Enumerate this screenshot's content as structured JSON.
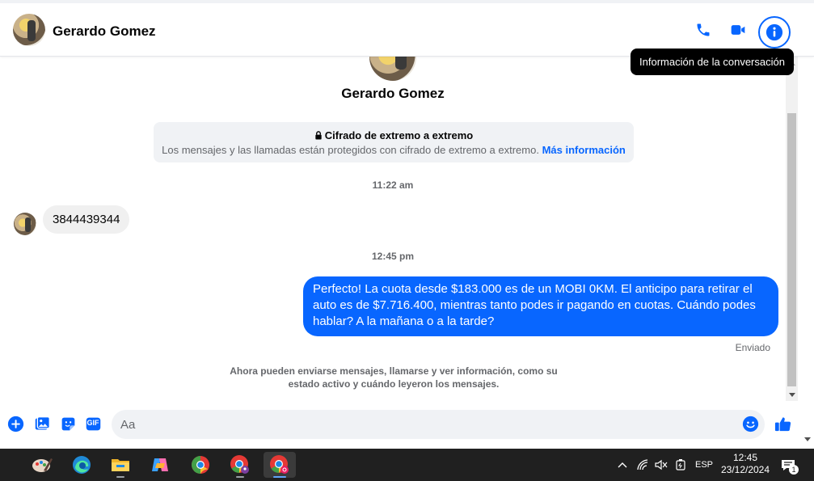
{
  "header": {
    "contact_name": "Gerardo Gomez",
    "icons": [
      "phone-icon",
      "video-icon",
      "info-icon"
    ],
    "tooltip": "Información de la conversación"
  },
  "conversation": {
    "contact_name": "Gerardo Gomez",
    "encryption": {
      "title": "Cifrado de extremo a extremo",
      "body": "Los mensajes y las llamadas están protegidos con cifrado de extremo a extremo.",
      "link": "Más información"
    },
    "messages": [
      {
        "time": "11:22 am",
        "direction": "in",
        "text": "3844439344"
      },
      {
        "time": "12:45 pm",
        "direction": "out",
        "text": "Perfecto! La cuota desde $183.000 es de un MOBI 0KM. El anticipo para retirar el auto es de $7.716.400, mientras tanto podes ir pagando en cuotas. Cuándo podes hablar? A la mañana o a la tarde?"
      }
    ],
    "status": "Enviado",
    "notice": "Ahora pueden enviarse mensajes, llamarse y ver información, como su estado activo y cuándo leyeron los mensajes."
  },
  "composer": {
    "placeholder": "Aa",
    "icons": [
      "plus-icon",
      "image-icon",
      "sticker-icon",
      "gif-icon",
      "emoji-icon",
      "like-icon"
    ],
    "gif_label": "GIF"
  },
  "colors": {
    "accent": "#0866ff",
    "incoming_bubble": "#f0f0f0",
    "taskbar": "#202020"
  },
  "taskbar": {
    "apps": [
      "task-view-icon",
      "paint-icon",
      "edge-icon",
      "file-explorer-icon",
      "copilot-icon",
      "chrome-icon",
      "chrome-profile-icon",
      "chrome-profile-active-icon"
    ],
    "language": "ESP",
    "time": "12:45",
    "date": "23/12/2024",
    "notification_count": "1"
  }
}
